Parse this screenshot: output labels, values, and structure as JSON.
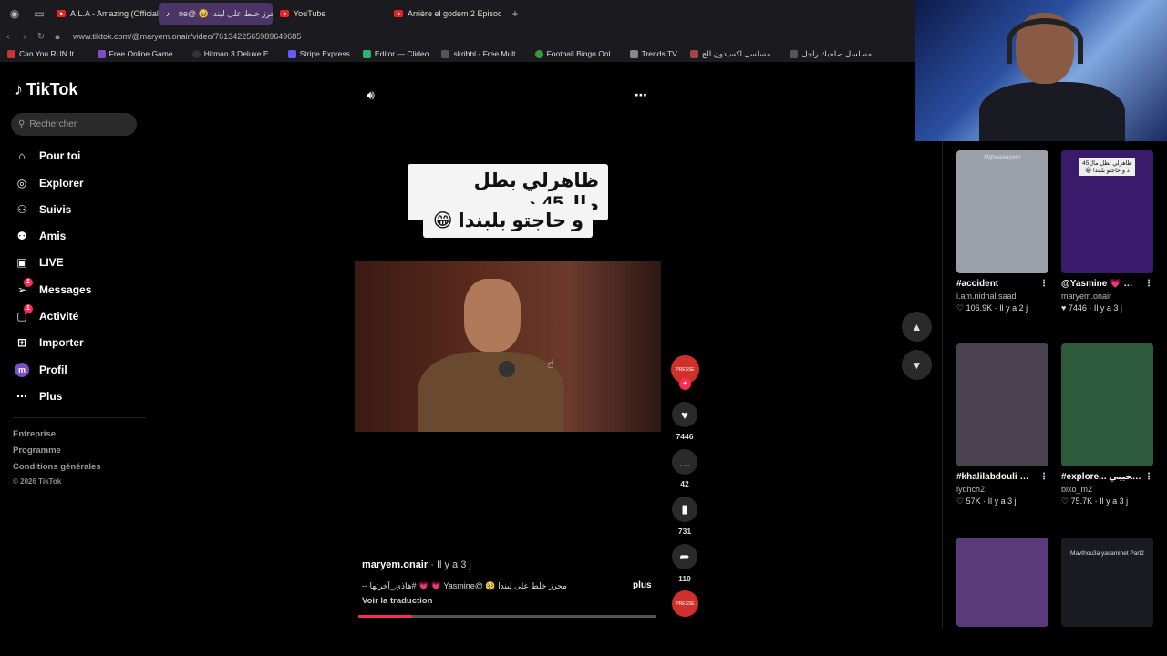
{
  "browser": {
    "tabs": [
      {
        "label": "A.L.A - Amazing (Official V",
        "icon": "youtube-icon",
        "active": false
      },
      {
        "label": "ne@ 🥹 محرز خلط على لبندا",
        "icon": "tiktok-icon",
        "active": true
      },
      {
        "label": "YouTube",
        "icon": "youtube-icon",
        "active": false
      },
      {
        "label": "Arrière el godem 2 Episod",
        "icon": "youtube-icon",
        "active": false
      }
    ],
    "new_tab": "+",
    "url": "www.tiktok.com/@maryem.onair/video/7613422565989649685",
    "bookmarks": [
      "Can You RUN It |...",
      "Free Online Game...",
      "Hitman 3 Deluxe E...",
      "Stripe Express",
      "Editor — Clideo",
      "skribbl - Free Mult...",
      "Football Bingo Onl...",
      "Trends TV",
      "مسلسل اكسيدون الح...",
      "مسلسل صاحبك راجل..."
    ]
  },
  "sidebar": {
    "logo": "TikTok",
    "search_placeholder": "Rechercher",
    "items": [
      {
        "label": "Pour toi",
        "icon": "home-icon"
      },
      {
        "label": "Explorer",
        "icon": "compass-icon"
      },
      {
        "label": "Suivis",
        "icon": "following-icon"
      },
      {
        "label": "Amis",
        "icon": "friends-icon"
      },
      {
        "label": "LIVE",
        "icon": "live-icon"
      },
      {
        "label": "Messages",
        "icon": "messages-icon",
        "badge": "1"
      },
      {
        "label": "Activité",
        "icon": "activity-icon",
        "badge": "1"
      },
      {
        "label": "Importer",
        "icon": "upload-icon"
      },
      {
        "label": "Profil",
        "icon": "profile-avatar",
        "avatar_letter": "m"
      },
      {
        "label": "Plus",
        "icon": "more-icon"
      }
    ],
    "footer": [
      "Entreprise",
      "Programme",
      "Conditions générales"
    ],
    "copyright": "© 2026 TikTok"
  },
  "video": {
    "caption_line1": "ظاهرلي بطل مال45 د",
    "caption_line2": "و حاجتو بلبندا 😁",
    "author": "maryem.onair",
    "time_ago": "· Il y a 3 j",
    "description": "-- هاذي_آخرتها# 💗 💗 Yasmine@ 🥹 محرز خلط على لبندا",
    "more": "plus",
    "translate": "Voir la traduction",
    "progress": 0.18,
    "creator_avatar_text": "PRESSE",
    "follow": "+",
    "likes": "7446",
    "comments": "42",
    "saves": "731",
    "shares": "110"
  },
  "navigation": {
    "up": "▲",
    "down": "▼"
  },
  "recommendations": [
    {
      "title": "#accident",
      "user": "i.am.nidhal.saadi",
      "likes": "106.9K",
      "age": "Il y a 2 j",
      "thumb_label": "Mghaaaayerrr",
      "thumb_color": "#9aa0a8"
    },
    {
      "title": "@Yasmine 💗 💗 ... 🥹 محرز خلط على لبندا",
      "user": "maryem.onair",
      "likes": "7446",
      "age": "Il y a 3 j",
      "thumb_label": "ظاهرلي بطل مال45 د و حاجتو بلبندا 😁",
      "thumb_color": "#3a1a6a"
    },
    {
      "title": "#khalilabdouli 🎤 🥹",
      "user": "iydhch2",
      "likes": "57K",
      "age": "Il y a 3 j",
      "thumb_label": "",
      "thumb_color": "#4a4250"
    },
    {
      "title": "#explore... خالتك #تسمحيبي 💗",
      "user": "bixo_m2",
      "likes": "75.7K",
      "age": "Il y a 3 j",
      "thumb_label": "",
      "thumb_color": "#2c5a3a"
    },
    {
      "title": "",
      "user": "",
      "likes": "",
      "age": "",
      "thumb_label": "",
      "thumb_color": "#5a3a7a"
    },
    {
      "title": "",
      "user": "",
      "likes": "",
      "age": "",
      "thumb_label": "Mavthou3a yasaminet Part2",
      "thumb_color": "#1a1a22"
    }
  ]
}
